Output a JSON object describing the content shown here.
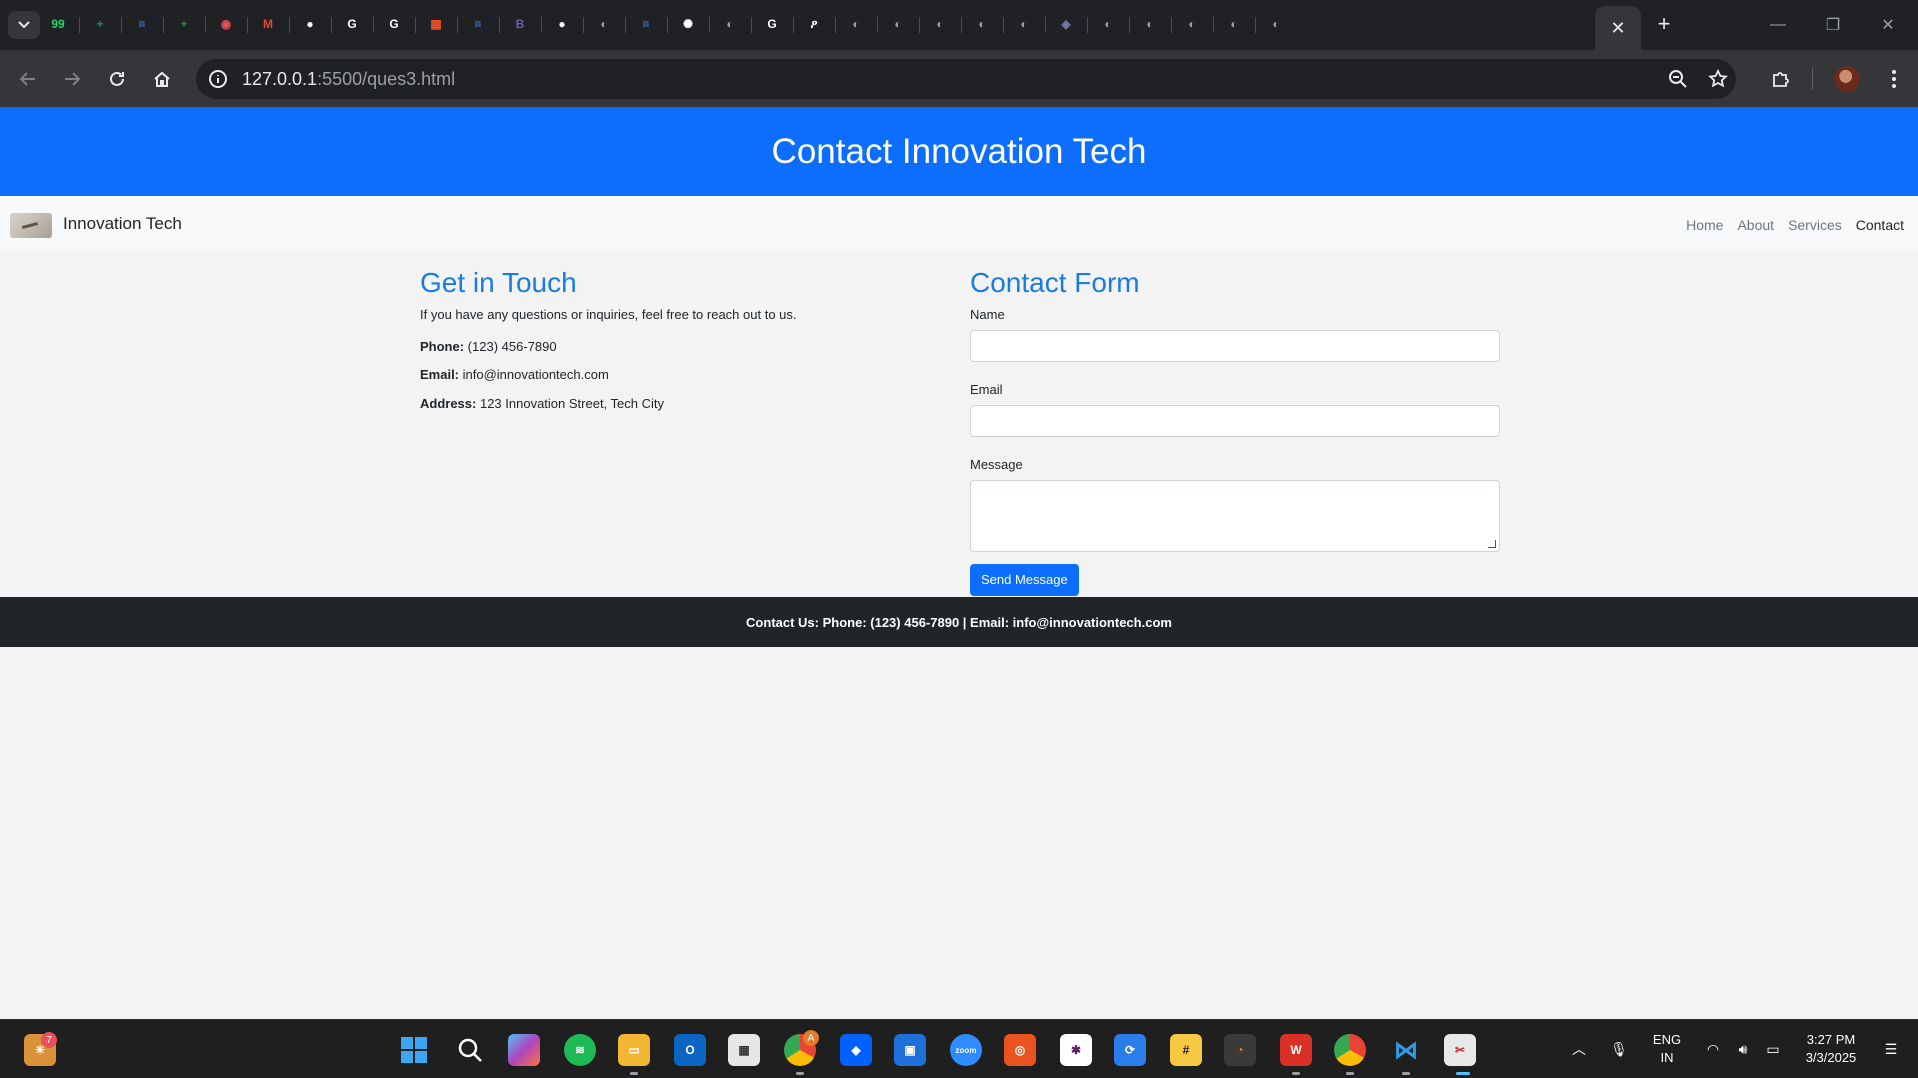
{
  "browser": {
    "tabs": [
      {
        "icon": "whatsapp-icon",
        "color": "#25d366",
        "glyph": "99"
      },
      {
        "icon": "sheets-icon",
        "color": "#1e8e3e",
        "glyph": "+"
      },
      {
        "icon": "docs-icon",
        "color": "#4285f4",
        "glyph": "≡"
      },
      {
        "icon": "sheets-icon",
        "color": "#1e8e3e",
        "glyph": "+"
      },
      {
        "icon": "record-icon",
        "color": "#e8505b",
        "glyph": "◉"
      },
      {
        "icon": "gmail-icon",
        "color": "#ea4335",
        "glyph": "M"
      },
      {
        "icon": "github-icon",
        "color": "#ffffff",
        "glyph": "●"
      },
      {
        "icon": "google-icon",
        "color": "#ffffff",
        "glyph": "G"
      },
      {
        "icon": "google-icon",
        "color": "#ffffff",
        "glyph": "G"
      },
      {
        "icon": "microsoft-icon",
        "color": "#f25022",
        "glyph": "▦"
      },
      {
        "icon": "docs-icon",
        "color": "#4285f4",
        "glyph": "≡"
      },
      {
        "icon": "bootstrap-icon",
        "color": "#7952b3",
        "glyph": "B"
      },
      {
        "icon": "github-icon",
        "color": "#ffffff",
        "glyph": "●"
      },
      {
        "icon": "globe-icon",
        "color": "#9aa0a6",
        "glyph": "◐"
      },
      {
        "icon": "docs-icon",
        "color": "#4285f4",
        "glyph": "≡"
      },
      {
        "icon": "chatgpt-icon",
        "color": "#ffffff",
        "glyph": "✺"
      },
      {
        "icon": "globe-icon",
        "color": "#9aa0a6",
        "glyph": "◐"
      },
      {
        "icon": "google-icon",
        "color": "#ffffff",
        "glyph": "G"
      },
      {
        "icon": "perplexity-icon",
        "color": "#ffffff",
        "glyph": "ዖ"
      },
      {
        "icon": "globe-icon",
        "color": "#9aa0a6",
        "glyph": "◐"
      },
      {
        "icon": "globe-icon",
        "color": "#9aa0a6",
        "glyph": "◐"
      },
      {
        "icon": "globe-icon",
        "color": "#9aa0a6",
        "glyph": "◐"
      },
      {
        "icon": "globe-icon",
        "color": "#9aa0a6",
        "glyph": "◐"
      },
      {
        "icon": "globe-icon",
        "color": "#9aa0a6",
        "glyph": "◐"
      },
      {
        "icon": "shield-icon",
        "color": "#6e7fb0",
        "glyph": "◈"
      },
      {
        "icon": "globe-icon",
        "color": "#9aa0a6",
        "glyph": "◐"
      },
      {
        "icon": "globe-icon",
        "color": "#9aa0a6",
        "glyph": "◐"
      },
      {
        "icon": "globe-icon",
        "color": "#9aa0a6",
        "glyph": "◐"
      },
      {
        "icon": "globe-icon",
        "color": "#9aa0a6",
        "glyph": "◐"
      },
      {
        "icon": "globe-icon",
        "color": "#9aa0a6",
        "glyph": "◐"
      }
    ],
    "active_tab_close": "✕",
    "new_tab": "+",
    "url_host": "127.0.0.1",
    "url_rest": ":5500/ques3.html"
  },
  "page": {
    "hero_title": "Contact Innovation Tech",
    "brand": "Innovation Tech",
    "nav": [
      "Home",
      "About",
      "Services",
      "Contact"
    ],
    "touch": {
      "heading": "Get in Touch",
      "intro": "If you have any questions or inquiries, feel free to reach out to us.",
      "phone_label": "Phone:",
      "phone": " (123) 456-7890",
      "email_label": "Email:",
      "email": " info@innovationtech.com",
      "address_label": "Address:",
      "address": " 123 Innovation Street, Tech City"
    },
    "form": {
      "heading": "Contact Form",
      "name_label": "Name",
      "name_value": "",
      "email_label": "Email",
      "email_value": "",
      "message_label": "Message",
      "message_value": "",
      "submit": "Send Message"
    },
    "footer": "Contact Us: Phone: (123) 456-7890 | Email: info@innovationtech.com"
  },
  "taskbar": {
    "chat_badge": "7",
    "chrome_badge": "A",
    "lang_top": "ENG",
    "lang_bottom": "IN",
    "time": "3:27 PM",
    "date": "3/3/2025"
  },
  "colors": {
    "hero": "#0d6efd",
    "heading": "#1a7ce0",
    "footer": "#212529"
  }
}
